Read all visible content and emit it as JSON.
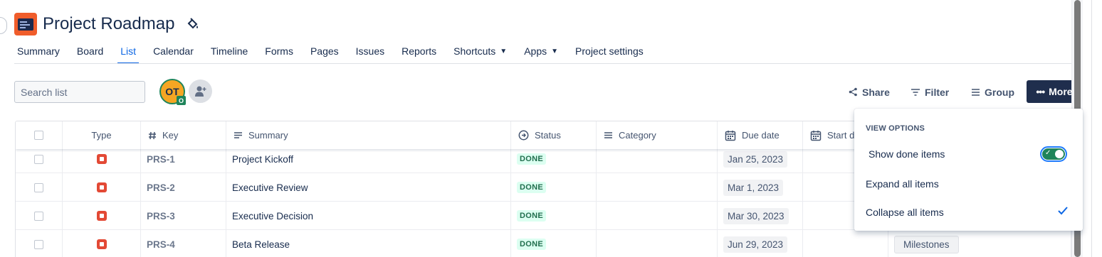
{
  "project": {
    "title": "Project Roadmap"
  },
  "tabs": [
    {
      "label": "Summary"
    },
    {
      "label": "Board"
    },
    {
      "label": "List",
      "active": true
    },
    {
      "label": "Calendar"
    },
    {
      "label": "Timeline"
    },
    {
      "label": "Forms"
    },
    {
      "label": "Pages"
    },
    {
      "label": "Issues"
    },
    {
      "label": "Reports"
    },
    {
      "label": "Shortcuts",
      "dropdown": true
    },
    {
      "label": "Apps",
      "dropdown": true
    },
    {
      "label": "Project settings"
    }
  ],
  "toolbar": {
    "search_placeholder": "Search list",
    "avatar_initials": "OT",
    "avatar_badge": "O",
    "share_label": "Share",
    "filter_label": "Filter",
    "group_label": "Group",
    "more_label": "More"
  },
  "table": {
    "headers": {
      "type": "Type",
      "key": "Key",
      "summary": "Summary",
      "status": "Status",
      "category": "Category",
      "due_date": "Due date",
      "start_date": "Start da"
    },
    "rows": [
      {
        "key": "PRS-1",
        "summary": "Project Kickoff",
        "status": "DONE",
        "due": "Jan 25, 2023"
      },
      {
        "key": "PRS-2",
        "summary": "Executive Review",
        "status": "DONE",
        "due": "Mar 1, 2023"
      },
      {
        "key": "PRS-3",
        "summary": "Executive Decision",
        "status": "DONE",
        "due": "Mar 30, 2023"
      },
      {
        "key": "PRS-4",
        "summary": "Beta Release",
        "status": "DONE",
        "due": "Jun 29, 2023",
        "extra": "Milestones"
      }
    ]
  },
  "view_options": {
    "heading": "VIEW OPTIONS",
    "show_done": "Show done items",
    "expand_all": "Expand all items",
    "collapse_all": "Collapse all items"
  },
  "colors": {
    "accent": "#0c66e4",
    "project_icon": "#f05d2b",
    "more_button": "#1f2e4d",
    "done_lozenge_bg": "#dcfff1",
    "done_lozenge_text": "#216e4e",
    "toggle_on": "#1f845a"
  }
}
